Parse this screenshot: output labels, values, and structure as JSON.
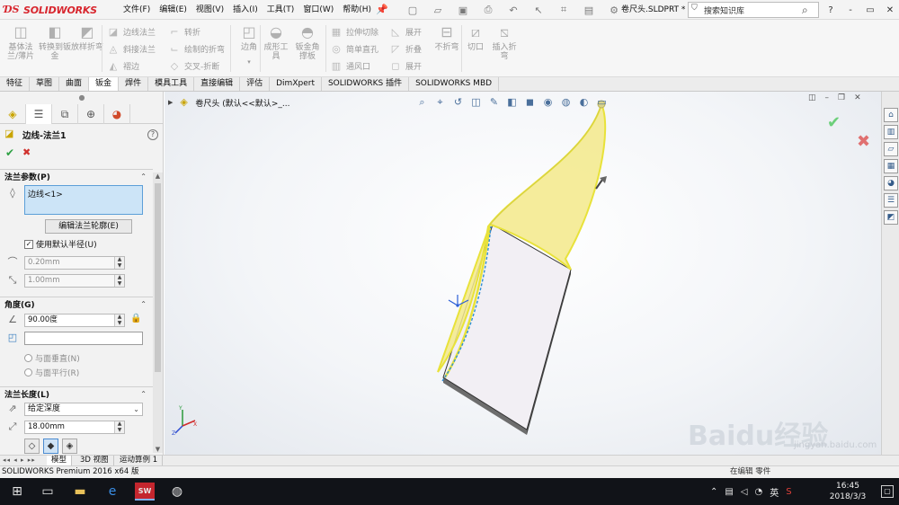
{
  "app": {
    "brand": "SOLIDWORKS",
    "filename": "卷尺头.SLDPRT *"
  },
  "menu": [
    "文件(F)",
    "编辑(E)",
    "视图(V)",
    "插入(I)",
    "工具(T)",
    "窗口(W)",
    "帮助(H)"
  ],
  "search": {
    "placeholder": "搜索知识库"
  },
  "window_controls": [
    "?",
    "-",
    "▭",
    "✕"
  ],
  "ribbon": {
    "big_buttons": [
      {
        "label": "基体法兰/薄片",
        "icon": "base-flange-icon"
      },
      {
        "label": "转换到钣金",
        "icon": "convert-sheet-metal-icon"
      },
      {
        "label": "放样折弯",
        "icon": "lofted-bend-icon"
      }
    ],
    "col1": [
      "边线法兰",
      "斜接法兰",
      "褶边"
    ],
    "col2": [
      "转折",
      "绘制的折弯",
      "交叉-折断"
    ],
    "corner": "边角",
    "forming_tool": "成形工具",
    "gusset": "钣金角撑板",
    "col3": [
      "拉伸切除",
      "简单直孔",
      "通风口"
    ],
    "col4": [
      "展开",
      "折叠",
      "展开"
    ],
    "no_bends": "不折弯",
    "rip": "切口",
    "insert_bends": "插入折弯"
  },
  "tabs": [
    "特征",
    "草图",
    "曲面",
    "钣金",
    "焊件",
    "模具工具",
    "直接编辑",
    "评估",
    "DimXpert",
    "SOLIDWORKS 插件",
    "SOLIDWORKS MBD"
  ],
  "active_tab": "钣金",
  "property_manager": {
    "title": "边线-法兰1",
    "flange_params": {
      "header": "法兰参数(P)",
      "edges": "边线<1>",
      "edit_profile_button": "编辑法兰轮廓(E)",
      "use_default_radius": "使用默认半径(U)",
      "radius": "0.20mm",
      "gap": "1.00mm"
    },
    "angle": {
      "header": "角度(G)",
      "value": "90.00度",
      "perpendicular": "与面垂直(N)",
      "parallel": "与面平行(R)"
    },
    "length": {
      "header": "法兰长度(L)",
      "end_condition": "给定深度",
      "value": "18.00mm"
    }
  },
  "viewport": {
    "tree_label": "卷尺头 (默认<<默认>_..."
  },
  "sheet_tabs": [
    "模型",
    "3D 视图",
    "运动算例 1"
  ],
  "status": {
    "text": "SOLIDWORKS Premium 2016 x64 版",
    "units": "在编辑 零件"
  },
  "taskbar": {
    "solidworks_badge": "SW 2016",
    "ime": "英",
    "time": "16:45",
    "date": "2018/3/3"
  },
  "watermark": {
    "brand": "Baidu经验",
    "url": "jingyan.baidu.com"
  },
  "colors": {
    "brand_red": "#d8262e",
    "flange_yellow": "#f3e98a",
    "edge_highlight": "#e8e23a"
  }
}
